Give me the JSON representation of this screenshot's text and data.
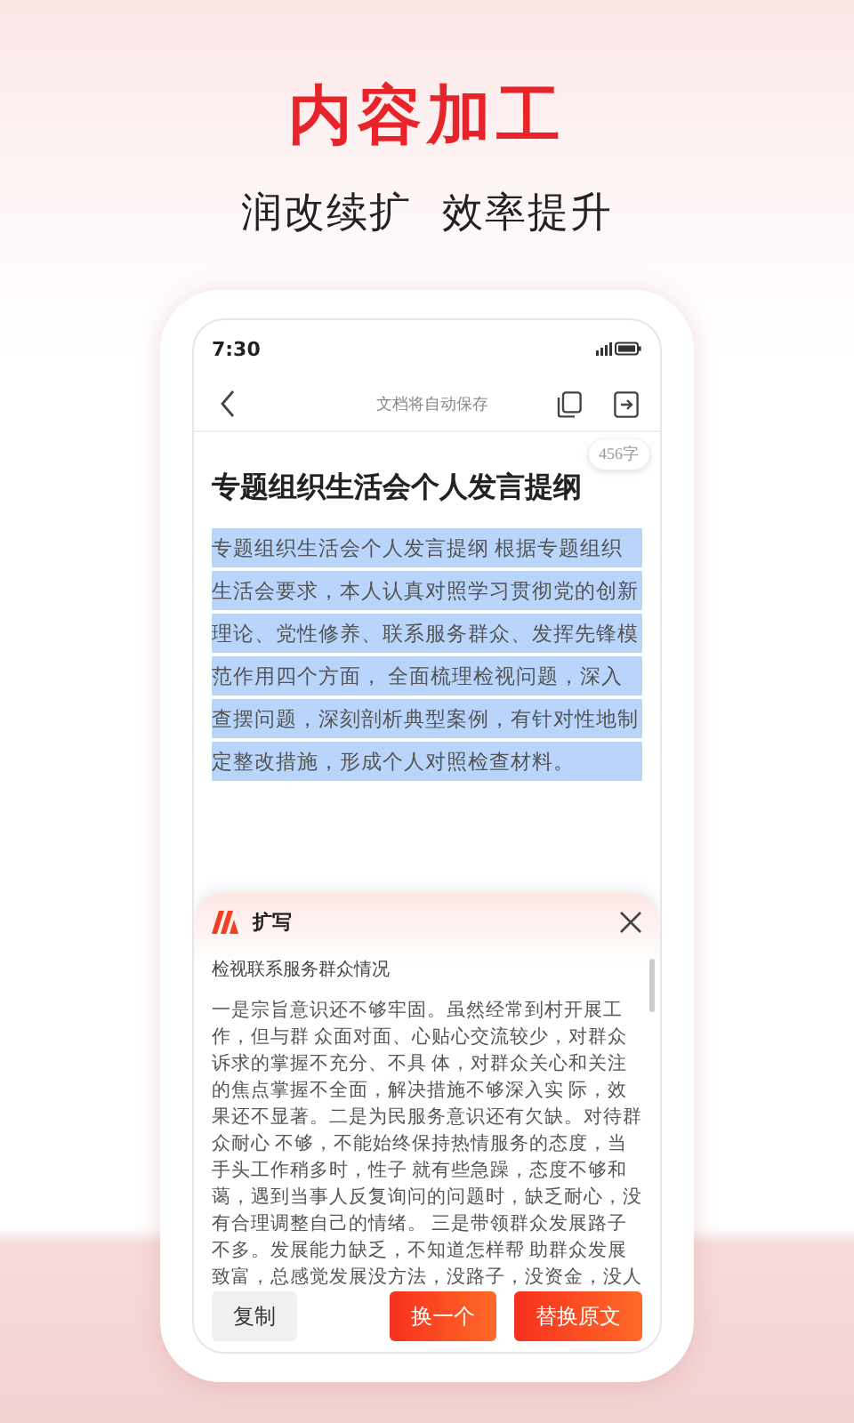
{
  "header": {
    "title": "内容加工",
    "subtitle": "润改续扩  效率提升"
  },
  "status_bar": {
    "time": "7:30"
  },
  "toolbar": {
    "title": "文档将自动保存"
  },
  "document": {
    "word_count": "456字",
    "title": "专题组织生活会个人发言提纲",
    "body": "专题组织生活会个人发言提纲 根据专题组织生活会要求，本人认真对照学习贯彻党的创新理论、党性修养、联系服务群众、发挥先锋模范作用四个方面， 全面梳理检视问题，深入查摆问题，深刻剖析典型案例，有针对性地制定整改措施，形成个人对照检查材料。",
    "selected": true
  },
  "panel": {
    "title": "扩写",
    "subtitle": "检视联系服务群众情况",
    "text": "一是宗旨意识还不够牢固。虽然经常到村开展工作，但与群 众面对面、心贴心交流较少，对群众诉求的掌握不充分、不具 体，对群众关心和关注的焦点掌握不全面，解决措施不够深入实 际，效果还不显著。二是为民服务意识还有欠缺。对待群众耐心 不够，不能始终保持热情服务的态度，当手头工作稍多时，性子 就有些急躁，态度不够和蔼，遇到当事人反复询问的问题时，缺乏耐心，没有合理调整自己的情绪。 三是带领群众发展路子不多。发展能力缺乏，不知道怎样帮 助群众发展致富，总感觉发展没方法，没路子，没资金，没人"
  },
  "buttons": [
    {
      "label": "复制",
      "kind": "secondary"
    },
    {
      "label": "换一个",
      "kind": "primary"
    },
    {
      "label": "替换原文",
      "kind": "primary"
    }
  ]
}
